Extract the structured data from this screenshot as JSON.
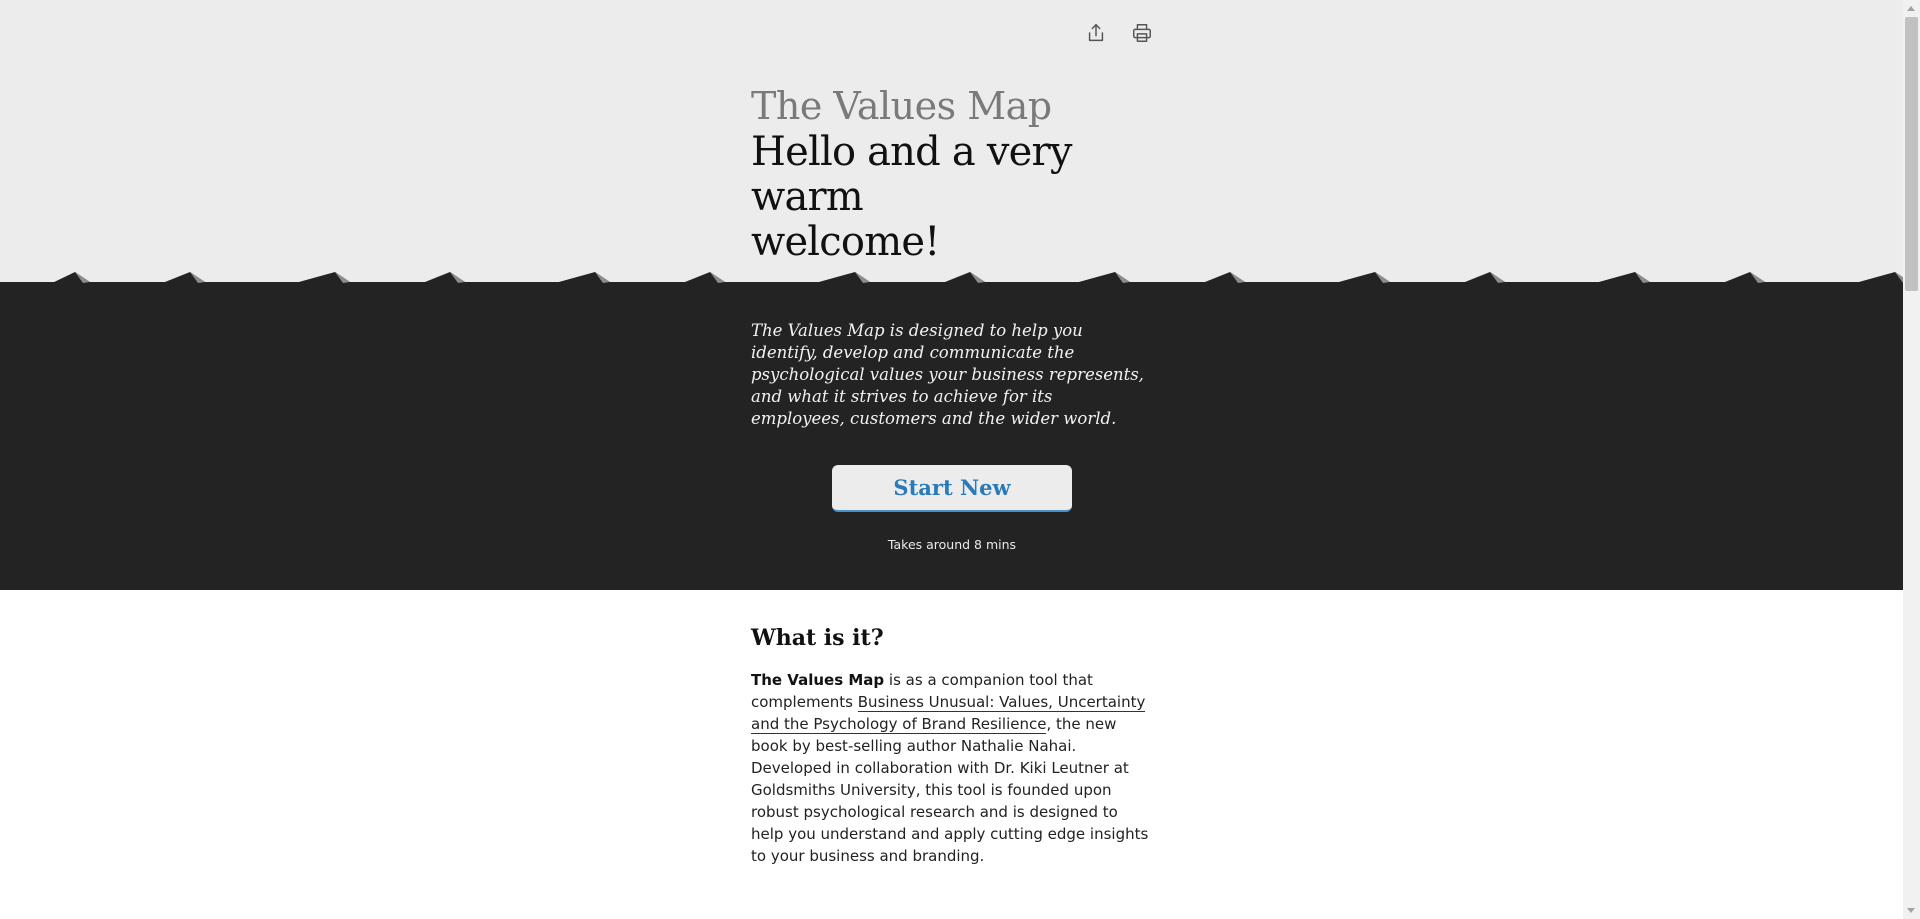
{
  "toolbar": {
    "share_icon": "share-icon",
    "print_icon": "print-icon"
  },
  "hero": {
    "app_title": "The Values Map",
    "welcome_line1": "Hello and a very warm",
    "welcome_line2": "welcome!",
    "intro": "The Values Map is designed to help you identify, develop and communicate the psychological values your business represents, and what it strives to achieve for its employees, customers and the wider world.",
    "start_button_label": "Start New",
    "duration_note": "Takes around 8 mins"
  },
  "about": {
    "heading": "What is it?",
    "body_bold": "The Values Map",
    "body_part1": " is as a companion tool that complements ",
    "book_link": "Business Unusual: Values, Uncertainty and the Psychology of Brand Resilience",
    "body_part2": ", the new book by best-selling author Nathalie Nahai. Developed in collaboration with Dr. Kiki Leutner at Goldsmiths University, this tool is founded upon robust psychological research and is designed to help you understand and apply cutting edge insights to your business and branding."
  },
  "colors": {
    "hero_light_bg": "#ececec",
    "hero_dark_bg": "#232323",
    "accent_blue": "#2a7ab8"
  }
}
